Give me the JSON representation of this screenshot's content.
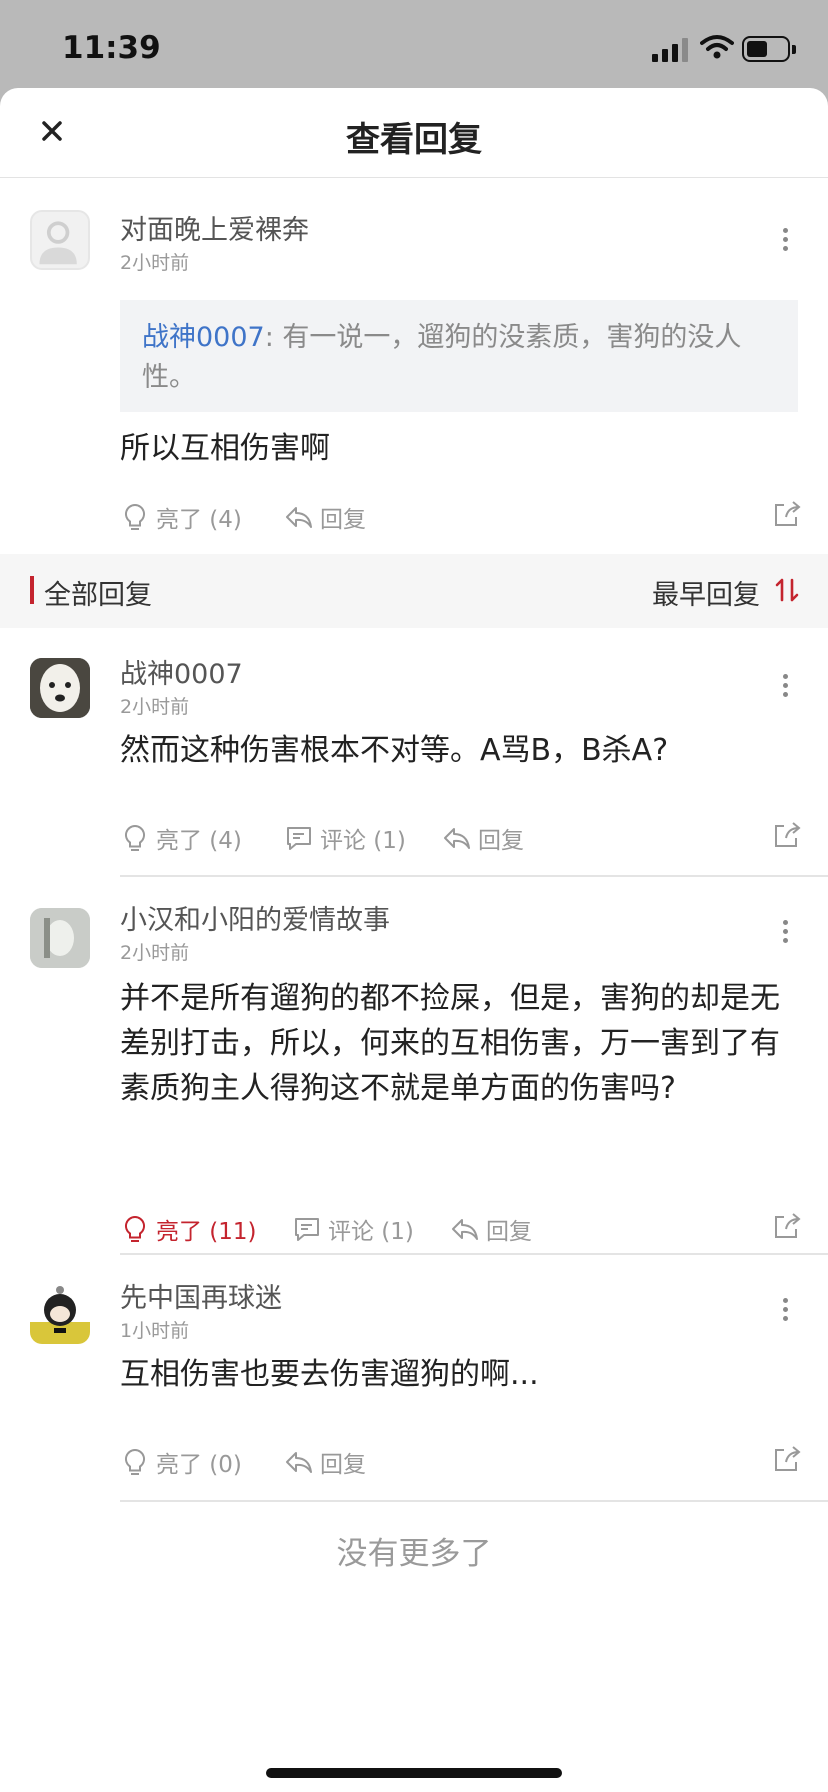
{
  "status_bar": {
    "time": "11:39"
  },
  "header": {
    "title": "查看回复"
  },
  "main_post": {
    "user": "对面晚上爱裸奔",
    "time": "2小时前",
    "quote": {
      "user": "战神0007",
      "sep": ": ",
      "text": "有一说一，遛狗的没素质，害狗的没人性。"
    },
    "text": "所以互相伤害啊",
    "likes": "亮了 (4)",
    "reply": "回复"
  },
  "section": {
    "all_replies": "全部回复",
    "sort": "最早回复"
  },
  "replies": [
    {
      "user": "战神0007",
      "time": "2小时前",
      "text": "然而这种伤害根本不对等。A骂B，B杀A?",
      "likes": "亮了 (4)",
      "comments": "评论 (1)",
      "reply": "回复",
      "liked": false
    },
    {
      "user": "小汉和小阳的爱情故事",
      "time": "2小时前",
      "text": "并不是所有遛狗的都不捡屎，但是，害狗的却是无差别打击，所以，何来的互相伤害，万一害到了有素质狗主人得狗这不就是单方面的伤害吗?",
      "likes": "亮了 (11)",
      "comments": "评论 (1)",
      "reply": "回复",
      "liked": true
    },
    {
      "user": "先中国再球迷",
      "time": "1小时前",
      "text": "互相伤害也要去伤害遛狗的啊...",
      "likes": "亮了 (0)",
      "reply": "回复",
      "liked": false
    }
  ],
  "footer": {
    "no_more": "没有更多了"
  },
  "colors": {
    "accent": "#c4242e",
    "link": "#3f74c8"
  },
  "icons": [
    "close-icon",
    "more-icon",
    "bulb-icon",
    "comment-icon",
    "reply-icon",
    "share-icon",
    "sort-icon"
  ]
}
